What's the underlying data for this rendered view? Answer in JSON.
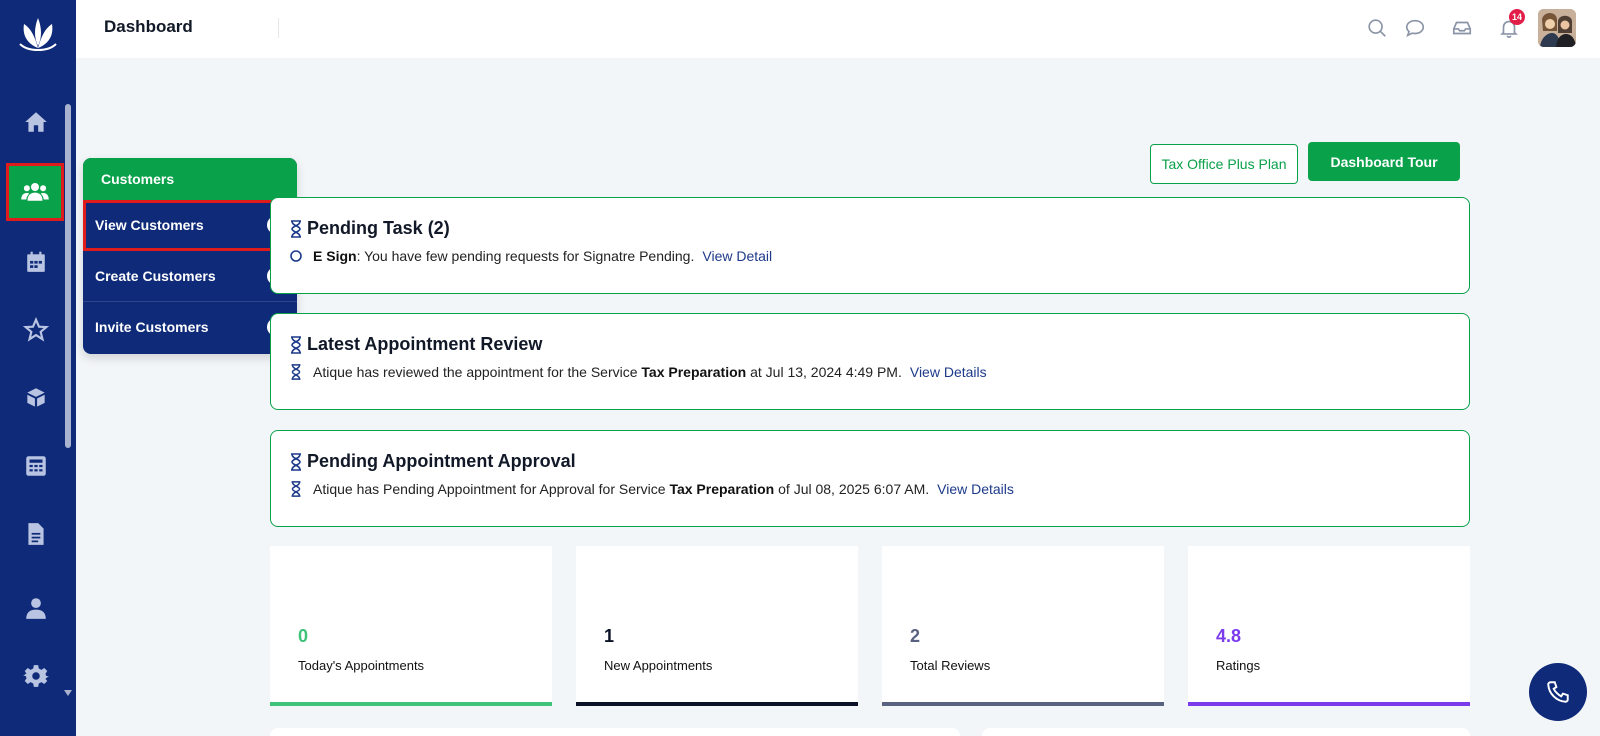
{
  "header": {
    "title": "Dashboard",
    "notification_count": "14"
  },
  "sidebar": {
    "items": [
      {
        "icon": "home-icon"
      },
      {
        "icon": "customers-icon",
        "active": true
      },
      {
        "icon": "calendar-icon"
      },
      {
        "icon": "star-icon"
      },
      {
        "icon": "box-icon"
      },
      {
        "icon": "calculator-icon"
      },
      {
        "icon": "document-icon"
      },
      {
        "icon": "user-icon"
      },
      {
        "icon": "gear-icon"
      }
    ]
  },
  "flyout": {
    "title": "Customers",
    "items": [
      {
        "label": "View Customers",
        "selected": true
      },
      {
        "label": "Create Customers"
      },
      {
        "label": "Invite Customers"
      }
    ]
  },
  "actions": {
    "plan_label": "Tax Office Plus Plan",
    "tour_label": "Dashboard Tour"
  },
  "cards": {
    "pending_task": {
      "title": "Pending Task (2)",
      "bold": "E Sign",
      "text": ": You have few pending requests for Signatre Pending.",
      "link": "View Detail"
    },
    "latest_review": {
      "title": "Latest Appointment Review",
      "text1": "Atique has reviewed the appointment for the Service ",
      "bold": "Tax Preparation",
      "text2": " at Jul 13, 2024 4:49 PM.",
      "link": "View Details"
    },
    "pending_approval": {
      "title": "Pending Appointment Approval",
      "text1": "Atique has Pending Appointment for Approval for Service ",
      "bold": "Tax Preparation",
      "text2": " of Jul 08, 2025 6:07 AM.",
      "link": "View Details"
    }
  },
  "stats": [
    {
      "value": "0",
      "label": "Today's Appointments",
      "color": "#3fc27a"
    },
    {
      "value": "1",
      "label": "New Appointments",
      "color": "#0b1226"
    },
    {
      "value": "2",
      "label": "Total Reviews",
      "color": "#5a6282"
    },
    {
      "value": "4.8",
      "label": "Ratings",
      "color": "#7c3aed"
    }
  ],
  "colors": {
    "primary": "#0e2a78",
    "accent": "#0aa14b",
    "highlight": "#e01b1b"
  }
}
